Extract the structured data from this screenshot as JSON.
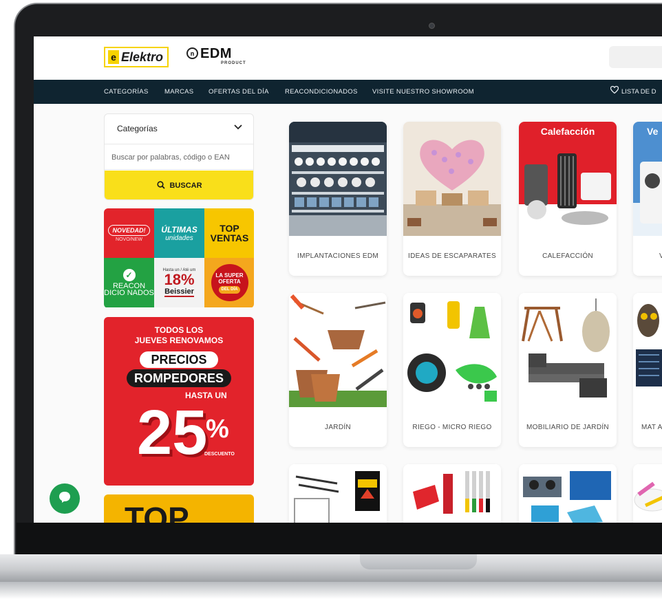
{
  "header": {
    "logo_elektro": "Elektro",
    "logo_edm": "EDM",
    "logo_edm_sub": "PRODUCT"
  },
  "nav": {
    "items": [
      "CATEGORÍAS",
      "MARCAS",
      "OFERTAS DEL DÍA",
      "REACONDICIONADOS",
      "VISITE NUESTRO SHOWROOM"
    ],
    "wishlist": "LISTA DE D"
  },
  "sidebar": {
    "filter_title": "Categorías",
    "search_placeholder": "Buscar por palabras, código o EAN",
    "search_button": "BUSCAR",
    "tiles": {
      "novedad": "NOVEDAD!",
      "novedad_sub": "NOVO/NEW",
      "ultimas_1": "ÚLTIMAS",
      "ultimas_2": "unidades",
      "top_1": "TOP",
      "top_2": "VENTAS",
      "reacon": "REACON DICIO NADOS",
      "beissier_top": "Hasta un / Até um",
      "beissier_pct": "18%",
      "beissier_name": "Beissier",
      "super_1": "LA SUPER",
      "super_2": "OFERTA",
      "super_3": "DEL DÍA"
    },
    "promo": {
      "line1": "TODOS LOS",
      "line2": "JUEVES RENOVAMOS",
      "pill1": "PRECIOS",
      "pill2": "ROMPEDORES",
      "hasta": "HASTA UN",
      "number": "25",
      "percent": "%",
      "descuento": "DESCUENTO"
    },
    "promo2": "TOP"
  },
  "categories": [
    {
      "label": "IMPLANTACIONES EDM",
      "badge": ""
    },
    {
      "label": "IDEAS DE ESCAPARATES",
      "badge": ""
    },
    {
      "label": "CALEFACCIÓN",
      "badge": "Calefacción"
    },
    {
      "label": "V",
      "badge": "Ve"
    },
    {
      "label": "JARDÍN",
      "badge": ""
    },
    {
      "label": "RIEGO - MICRO RIEGO",
      "badge": ""
    },
    {
      "label": "MOBILIARIO DE JARDÍN",
      "badge": ""
    },
    {
      "label": "MAT AHU",
      "badge": ""
    }
  ],
  "colors": {
    "nav_bg": "#0f2430",
    "accent_yellow": "#f9df1a",
    "promo_red": "#e2232b",
    "chat_green": "#1e9e50"
  }
}
